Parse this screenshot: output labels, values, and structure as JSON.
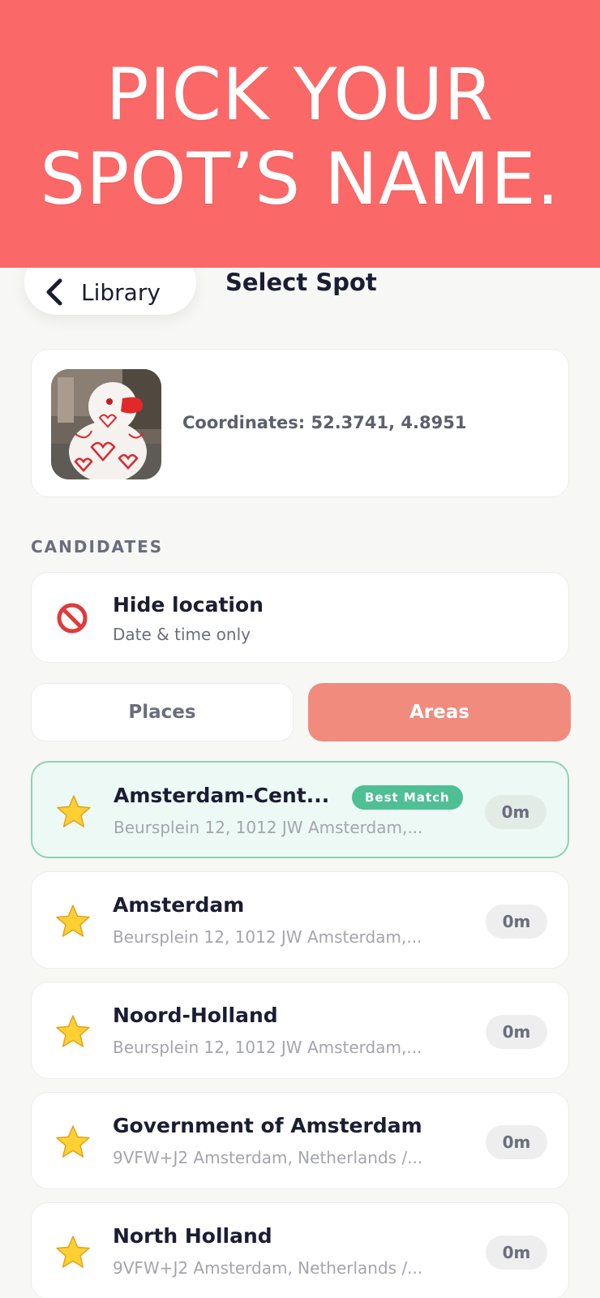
{
  "banner": {
    "line1": "PICK YOUR",
    "line2": "SPOT’S NAME."
  },
  "header": {
    "back_label": "Library",
    "title": "Select Spot"
  },
  "photo": {
    "coordinates": "Coordinates: 52.3741, 4.8951"
  },
  "section": {
    "candidates_label": "CANDIDATES"
  },
  "hide_location": {
    "title": "Hide location",
    "subtitle": "Date & time only"
  },
  "tabs": [
    {
      "label": "Places",
      "active": false
    },
    {
      "label": "Areas",
      "active": true
    }
  ],
  "candidates": [
    {
      "name": "Amsterdam-Cent...",
      "address": "Beursplein 12, 1012 JW Amsterdam,...",
      "distance": "0m",
      "badge": "Best Match"
    },
    {
      "name": "Amsterdam",
      "address": "Beursplein 12, 1012 JW Amsterdam,...",
      "distance": "0m"
    },
    {
      "name": "Noord-Holland",
      "address": "Beursplein 12, 1012 JW Amsterdam,...",
      "distance": "0m"
    },
    {
      "name": "Government of Amsterdam",
      "address": "9VFW+J2 Amsterdam, Netherlands /...",
      "distance": "0m"
    },
    {
      "name": "North Holland",
      "address": "9VFW+J2 Amsterdam, Netherlands /...",
      "distance": "0m"
    }
  ],
  "colors": {
    "banner": "#fb6868",
    "accent_tab": "#f08b7e",
    "best_match": "#4fbf94",
    "best_match_bg": "#ecf9f4"
  },
  "icons": {
    "back": "chevron-left-icon",
    "hide": "no-entry-icon",
    "candidate": "star-icon"
  }
}
